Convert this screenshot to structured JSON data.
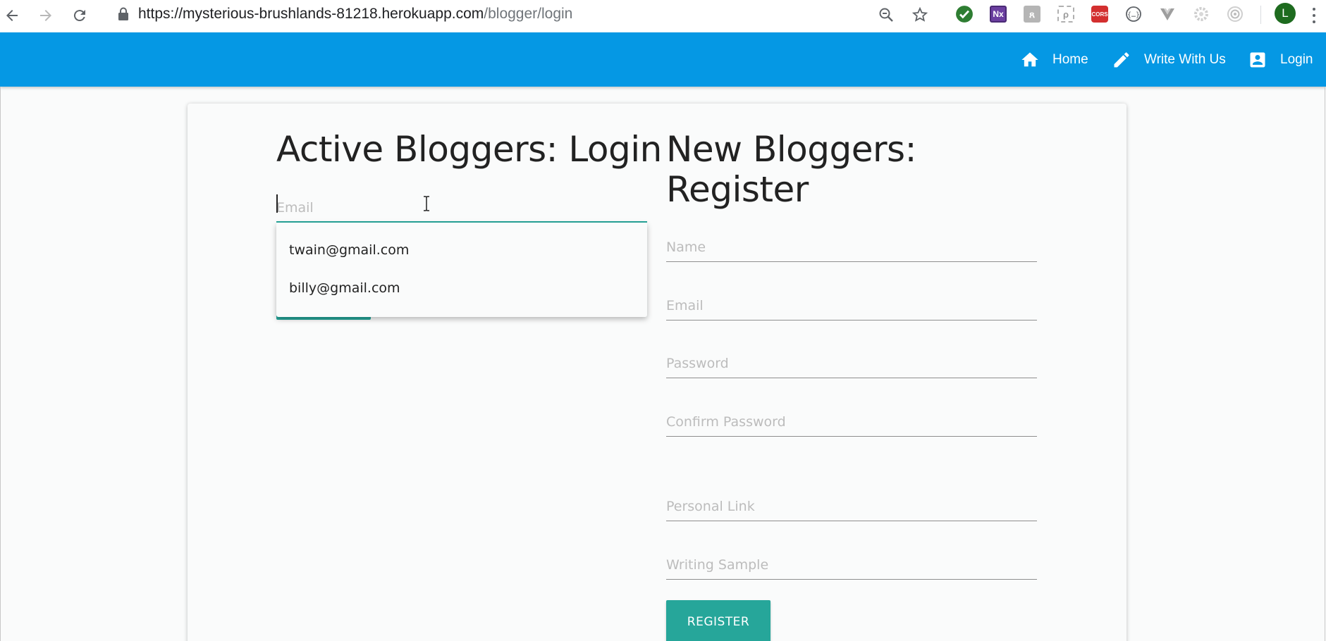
{
  "browser": {
    "url_host": "https://mysterious-brushlands-81218.herokuapp.com",
    "url_path": "/blogger/login",
    "back_icon": "arrow-left-icon",
    "forward_icon": "arrow-right-icon",
    "reload_icon": "reload-icon",
    "lock_icon": "lock-icon",
    "zoom_icon": "zoom-out-icon",
    "bookmark_icon": "star-icon",
    "extensions": [
      {
        "name": "check-extension",
        "color": "#2e7d32"
      },
      {
        "name": "nx-extension",
        "label": "Nx",
        "color": "#6b3fa0"
      },
      {
        "name": "gray-extension-1",
        "color": "#b0b0b0"
      },
      {
        "name": "dashed-extension",
        "color": "#b0b0b0"
      },
      {
        "name": "cors-extension",
        "label": "CORS",
        "color": "#d32f2f"
      },
      {
        "name": "braces-extension",
        "color": "#5f6368"
      },
      {
        "name": "vue-extension",
        "color": "#9e9e9e"
      },
      {
        "name": "gear-extension",
        "color": "#c8c8c8"
      },
      {
        "name": "target-extension",
        "color": "#c8c8c8"
      }
    ],
    "profile_initial": "L",
    "profile_color": "#1e6b1f"
  },
  "appbar": {
    "color": "#0598e4",
    "nav": [
      {
        "label": "Home",
        "icon": "home-icon"
      },
      {
        "label": "Write With Us",
        "icon": "pencil-icon"
      },
      {
        "label": "Login",
        "icon": "account-box-icon"
      }
    ]
  },
  "login": {
    "title": "Active Bloggers: Login",
    "email_placeholder": "Email",
    "email_value": "",
    "autocomplete": [
      "twain@gmail.com",
      "billy@gmail.com"
    ]
  },
  "register": {
    "title_line1": "New Bloggers:",
    "title_line2": "Register",
    "fields": [
      {
        "placeholder": "Name"
      },
      {
        "placeholder": "Email"
      },
      {
        "placeholder": "Password"
      },
      {
        "placeholder": "Confirm Password"
      },
      {
        "placeholder": "Personal Link"
      },
      {
        "placeholder": "Writing Sample"
      }
    ],
    "button_label": "Register",
    "accent_color": "#26a69a"
  }
}
